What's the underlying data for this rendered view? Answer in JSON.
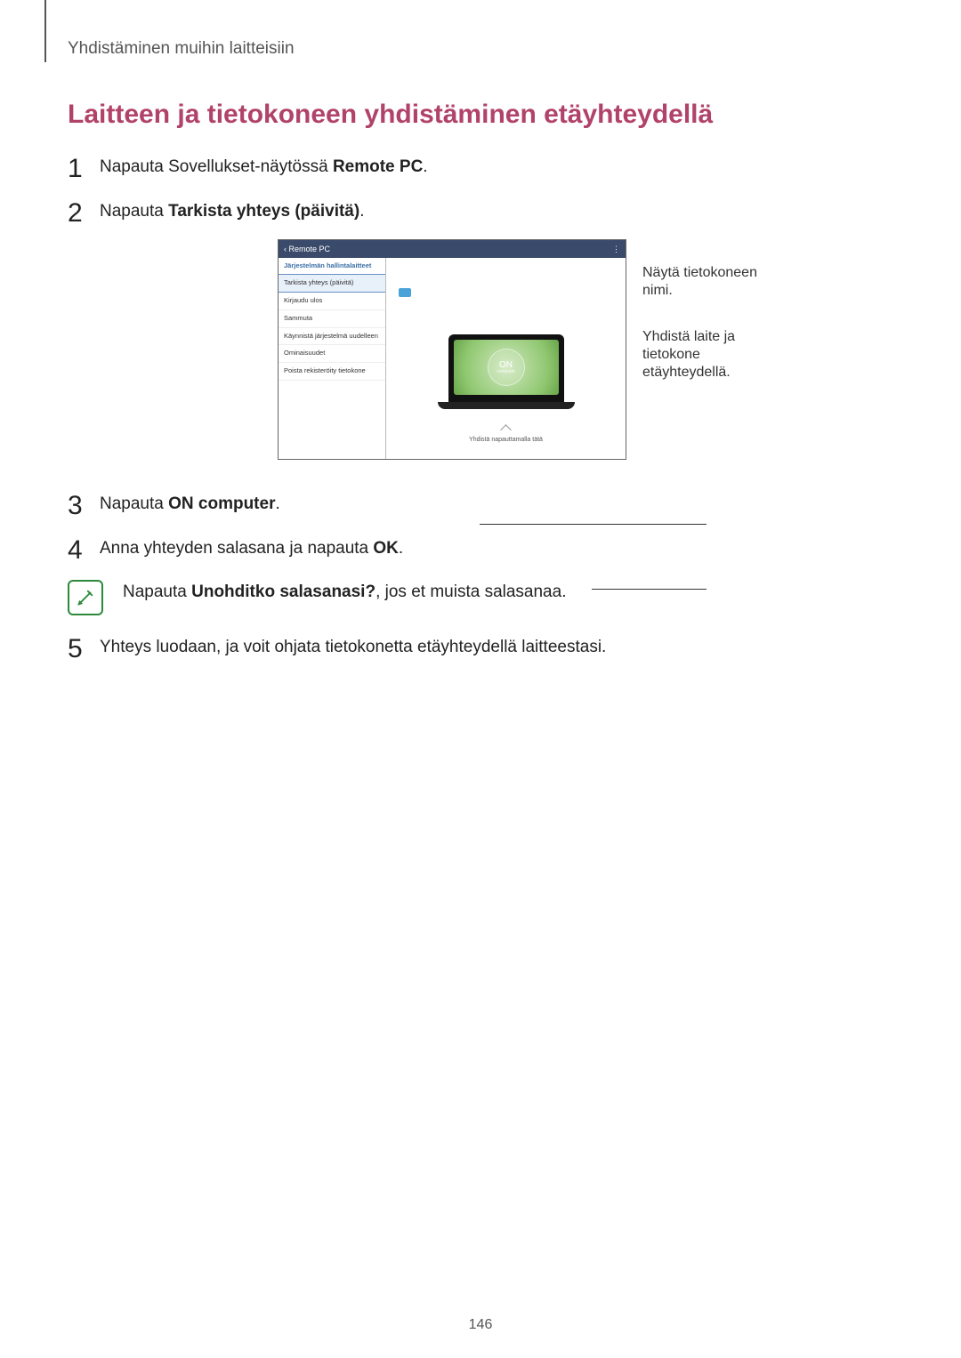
{
  "breadcrumb": "Yhdistäminen muihin laitteisiin",
  "heading": "Laitteen ja tietokoneen yhdistäminen etäyhteydellä",
  "steps": {
    "s1": {
      "num": "1",
      "pre": "Napauta Sovellukset-näytössä ",
      "bold": "Remote PC",
      "post": "."
    },
    "s2": {
      "num": "2",
      "pre": "Napauta ",
      "bold": "Tarkista yhteys (päivitä)",
      "post": "."
    },
    "s3": {
      "num": "3",
      "pre": "Napauta ",
      "bold": "ON computer",
      "post": "."
    },
    "s4": {
      "num": "4",
      "pre": "Anna yhteyden salasana ja napauta ",
      "bold": "OK",
      "post": "."
    },
    "note": {
      "pre": "Napauta ",
      "bold": "Unohditko salasanasi?",
      "post": ", jos et muista salasanaa."
    },
    "s5": {
      "num": "5",
      "text": "Yhteys luodaan, ja voit ohjata tietokonetta etäyhteydellä laitteestasi."
    }
  },
  "mock": {
    "title": "Remote PC",
    "menu_dots": "⋮",
    "sidebar_header": "Järjestelmän hallintalaitteet",
    "items": [
      "Tarkista yhteys (päivitä)",
      "Kirjaudu ulos",
      "Sammuta",
      "Käynnistä järjestelmä uudelleen",
      "Ominaisuudet",
      "Poista rekisteröity tietokone"
    ],
    "on_label": "ON",
    "on_sub": "computer",
    "tap_hint": "Yhdistä napauttamalla tätä"
  },
  "callouts": {
    "c1": "Näytä tietokoneen nimi.",
    "c2": "Yhdistä laite ja tietokone etäyhteydellä."
  },
  "page_number": "146"
}
